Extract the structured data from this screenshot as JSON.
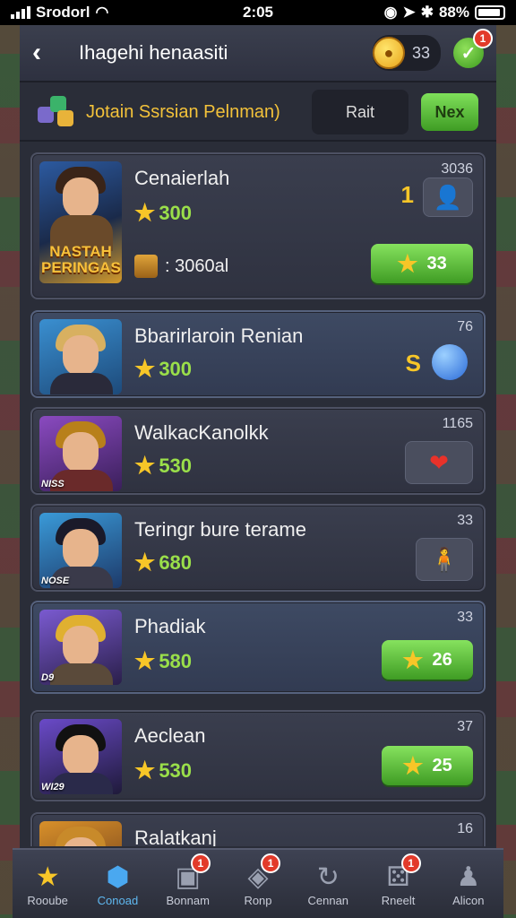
{
  "status_bar": {
    "carrier": "Srodorl",
    "time": "2:05",
    "battery": "88%"
  },
  "header": {
    "title": "Ihagehi henaasiti",
    "currency_value": "33",
    "check_badge": "1"
  },
  "subheader": {
    "title": "Jotain Ssrsian Pelnman)",
    "sort_label": "Rait",
    "next_label": "Nex"
  },
  "cards": [
    {
      "name": "Cenaierlah",
      "stars": "300",
      "rank": "3036",
      "portrait_label": "NASTAH PERINGAS",
      "side_num": "1",
      "scroll_text": ": 3060al",
      "reward": "33",
      "icon": "character-portrait-icon"
    },
    {
      "name": "Bbarirlaroin Renian",
      "stars": "300",
      "rank": "76",
      "side_num": "S",
      "icon": "blue-gem-icon"
    },
    {
      "name": "WalkacKanolkk",
      "stars": "530",
      "rank": "1165",
      "portrait_tag": "NISS",
      "icon": "heart-icon"
    },
    {
      "name": "Teringr bure terame",
      "stars": "680",
      "rank": "33",
      "portrait_tag": "NOSE",
      "icon": "character-small-icon"
    },
    {
      "name": "Phadiak",
      "stars": "580",
      "rank": "33",
      "portrait_tag": "D9",
      "reward": "26"
    },
    {
      "name": "Aeclean",
      "stars": "530",
      "rank": "37",
      "portrait_tag": "WI29",
      "reward": "25"
    },
    {
      "name": "Ralatkanj",
      "rank": "16"
    }
  ],
  "bottom_nav": [
    {
      "label": "Rooube",
      "icon": "star-icon"
    },
    {
      "label": "Conoad",
      "icon": "gem-icon",
      "active": true
    },
    {
      "label": "Bonnam",
      "icon": "chest-icon",
      "badge": "1"
    },
    {
      "label": "Ronp",
      "icon": "controller-icon",
      "badge": "1"
    },
    {
      "label": "Cennan",
      "icon": "refresh-icon"
    },
    {
      "label": "Rneelt",
      "icon": "dice-icon",
      "badge": "1"
    },
    {
      "label": "Alicon",
      "icon": "person-icon"
    }
  ],
  "colors": {
    "accent_green": "#4fb02e",
    "star_gold": "#f7c628",
    "title_gold": "#f3c23a",
    "active_blue": "#5fb8f0",
    "badge_red": "#e23a2a"
  }
}
